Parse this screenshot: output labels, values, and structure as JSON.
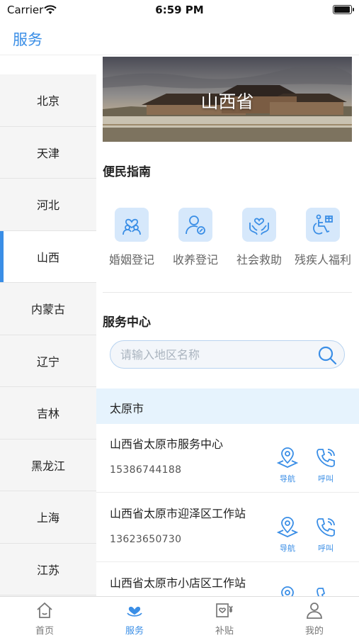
{
  "status": {
    "carrier": "Carrier",
    "time": "6:59 PM",
    "battery_level": 0.95
  },
  "nav": {
    "title": "服务"
  },
  "sidebar": {
    "items": [
      {
        "label": "北京",
        "active": false
      },
      {
        "label": "天津",
        "active": false
      },
      {
        "label": "河北",
        "active": false
      },
      {
        "label": "山西",
        "active": true
      },
      {
        "label": "内蒙古",
        "active": false
      },
      {
        "label": "辽宁",
        "active": false
      },
      {
        "label": "吉林",
        "active": false
      },
      {
        "label": "黑龙江",
        "active": false
      },
      {
        "label": "上海",
        "active": false
      },
      {
        "label": "江苏",
        "active": false
      }
    ]
  },
  "banner": {
    "title": "山西省"
  },
  "guide": {
    "title": "便民指南",
    "items": [
      {
        "label": "婚姻登记",
        "icon": "marriage-icon"
      },
      {
        "label": "收养登记",
        "icon": "adoption-icon"
      },
      {
        "label": "社会救助",
        "icon": "social-aid-icon"
      },
      {
        "label": "残疾人福利",
        "icon": "disability-welfare-icon"
      }
    ]
  },
  "service_center": {
    "title": "服务中心",
    "search_placeholder": "请输入地区名称",
    "region": "太原市",
    "stations": [
      {
        "name": "山西省太原市服务中心",
        "phone": "15386744188"
      },
      {
        "name": "山西省太原市迎泽区工作站",
        "phone": "13623650730"
      },
      {
        "name": "山西省太原市小店区工作站",
        "phone": ""
      }
    ],
    "nav_label": "导航",
    "call_label": "呼叫"
  },
  "tabs": [
    {
      "label": "首页",
      "icon": "home-icon",
      "active": false
    },
    {
      "label": "服务",
      "icon": "heart-hand-icon",
      "active": true
    },
    {
      "label": "补贴",
      "icon": "subsidy-icon",
      "active": false
    },
    {
      "label": "我的",
      "icon": "profile-icon",
      "active": false
    }
  ],
  "colors": {
    "accent": "#3a8ee6",
    "icon_bg": "#d6e8fb",
    "region_bg": "#e6f3fd"
  }
}
